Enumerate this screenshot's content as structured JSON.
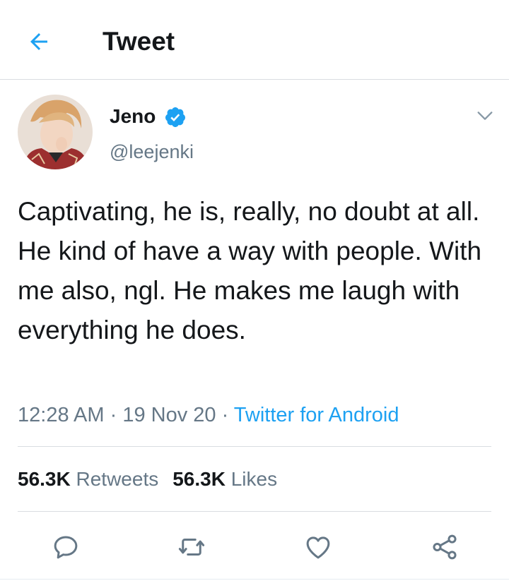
{
  "header": {
    "title": "Tweet",
    "back_icon": "arrow-left-icon",
    "accent_color": "#1da1f2"
  },
  "tweet": {
    "author_name": "Jeno",
    "author_handle": "@leejenki",
    "verified": true,
    "text": "Captivating, he is, really, no doubt at all. He kind of have a way with people. With me also, ngl. He makes me laugh with everything he does.",
    "time": "12:28 AM",
    "sep1": " · ",
    "date": "19 Nov 20",
    "sep2": " · ",
    "source": "Twitter for Android"
  },
  "stats": {
    "retweets_count": "56.3K",
    "retweets_label": "Retweets",
    "likes_count": "56.3K",
    "likes_label": "Likes"
  },
  "actions": {
    "icons": [
      "reply-icon",
      "retweet-icon",
      "like-icon",
      "share-icon"
    ]
  },
  "colors": {
    "text_primary": "#14171a",
    "text_secondary": "#657786",
    "link": "#1da1f2",
    "divider": "#d9dde1"
  }
}
